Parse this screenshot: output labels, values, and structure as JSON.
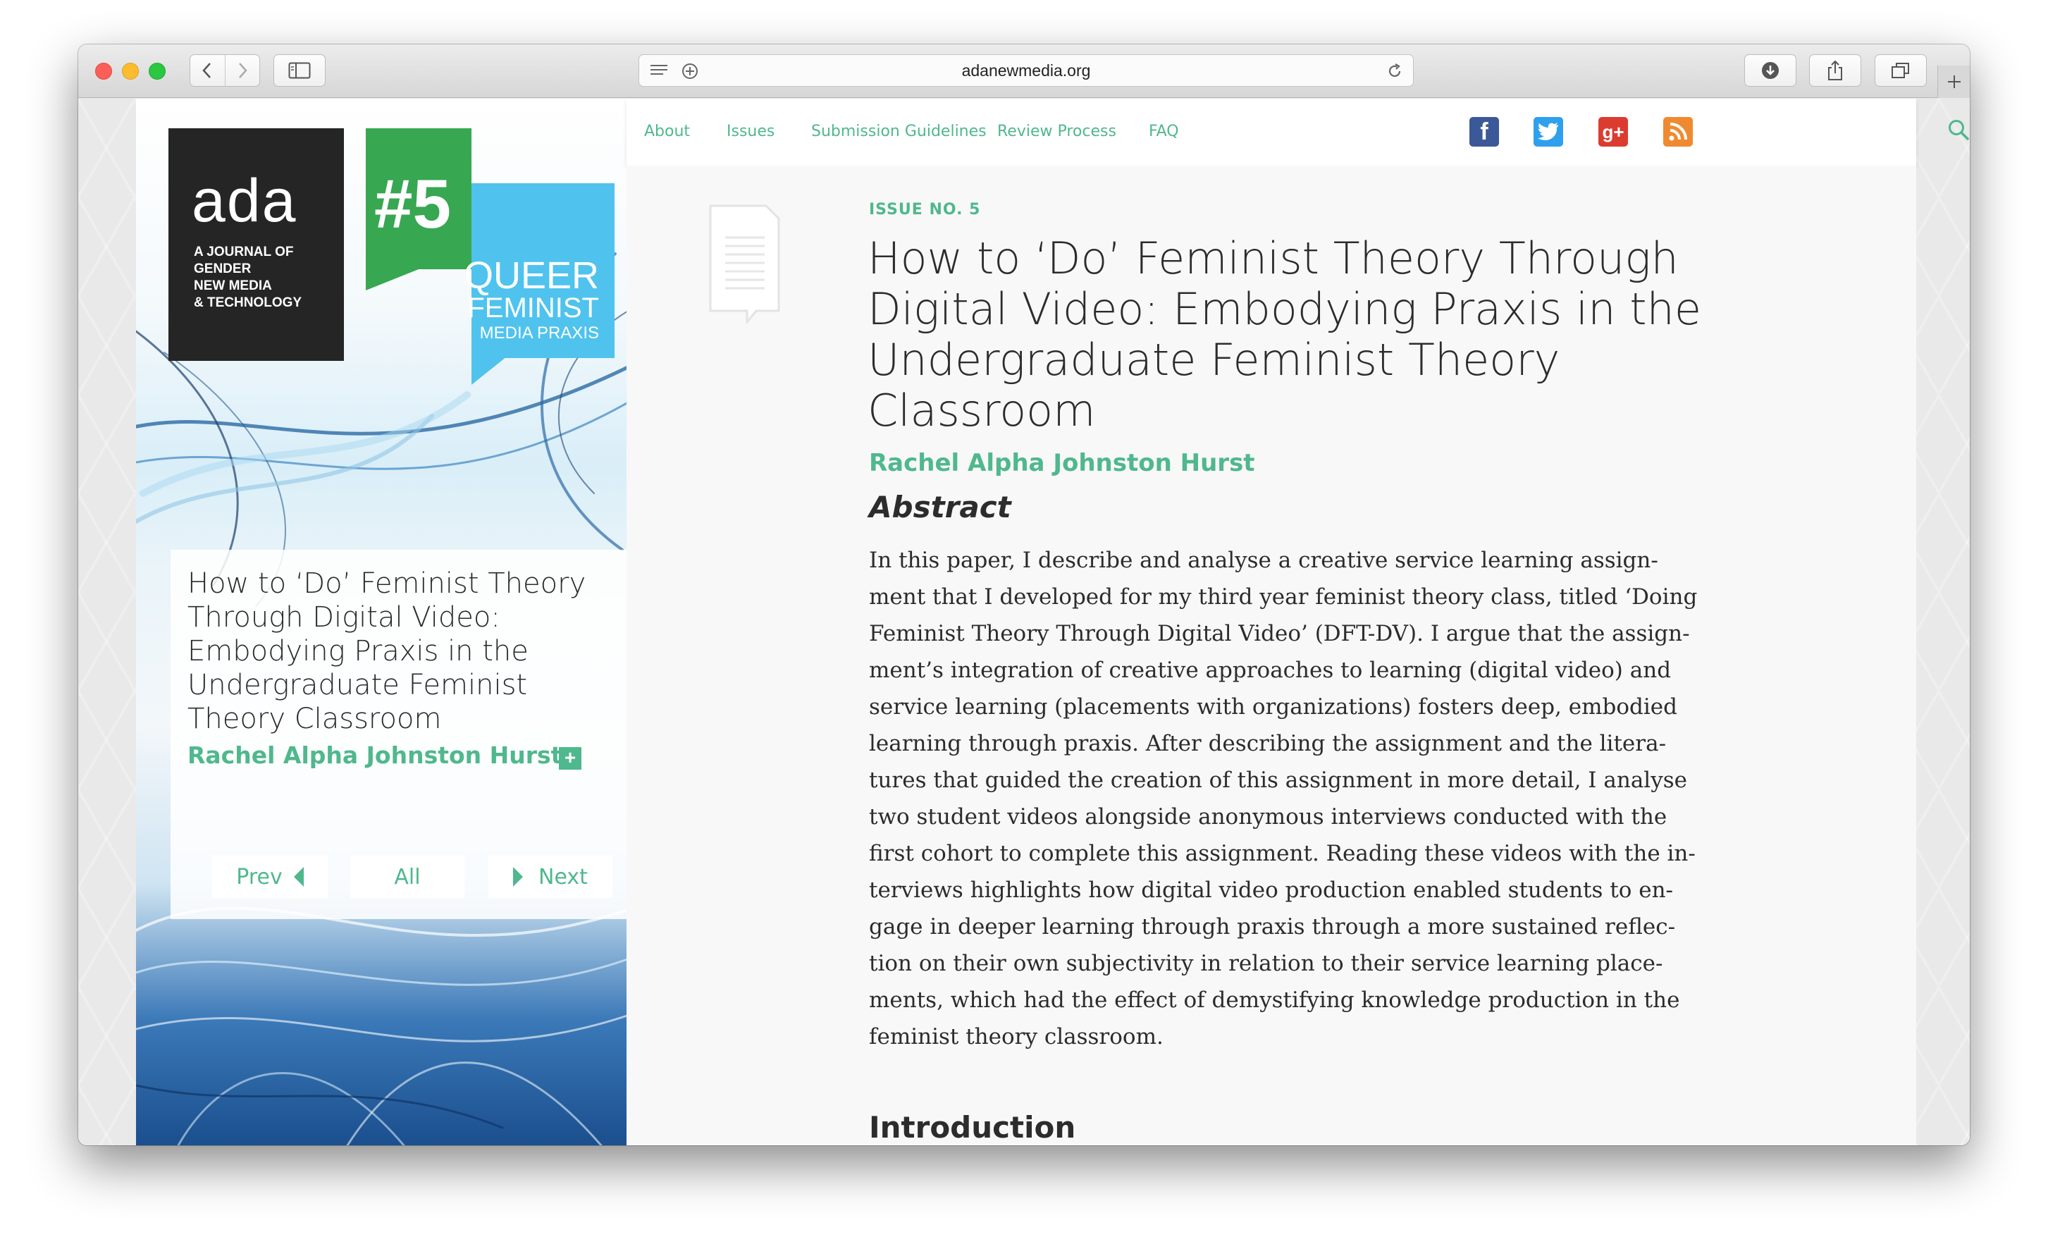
{
  "browser": {
    "url": "adanewmedia.org"
  },
  "cover": {
    "logo": "ada",
    "tagline": [
      "A JOURNAL OF",
      "GENDER",
      "NEW MEDIA",
      "& TECHNOLOGY"
    ],
    "issue_number": "#5",
    "issue_theme": [
      "QUEER",
      "FEMINIST",
      "MEDIA PRAXIS"
    ],
    "card_title": "How to ‘Do’ Feminist Theory Through Digital Video: Embodying Praxis in the Undergraduate Feminist Theory Classroom",
    "card_author": "Rachel Alpha Johnston Hurst",
    "expand_symbol": "+",
    "pager": {
      "prev": "Prev",
      "all": "All",
      "next": "Next"
    }
  },
  "nav": {
    "items": [
      "About",
      "Issues",
      "Submission Guidelines",
      "Review Process",
      "FAQ"
    ]
  },
  "social": {
    "facebook": "f",
    "googleplus": "g+"
  },
  "article": {
    "issue_label": "ISSUE NO. 5",
    "title": "How to ‘Do’ Feminist Theory Through Digital Video: Embodying Praxis in the Undergraduate Feminist Theory Classroom",
    "author": "Rachel Alpha Johnston Hurst",
    "abstract_heading": "Abstract",
    "abstract_lines": [
      "In this paper, I describe and analyse a creative service learning assign-",
      "ment that I developed for my third year feminist theory class, titled ‘Doing",
      "Feminist Theory Through Digital Video’ (DFT-DV). I argue that the assign-",
      "ment’s integration of creative approaches to learning (digital video) and",
      "service learning (placements with organizations) fosters deep, embodied",
      "learning through praxis. After describing the assignment and the litera-",
      "tures that guided the creation of this assignment in more detail, I analyse",
      "two student videos alongside anonymous interviews conducted with the",
      "first cohort to complete this assignment. Reading these videos with the in-",
      "terviews highlights how digital video production enabled students to en-",
      "gage in deeper learning through praxis through a more sustained reflec-",
      "tion on their own subjectivity in relation to their service learning place-",
      "ments, which had the effect of demystifying knowledge production in the",
      "feminist theory classroom."
    ],
    "next_heading": "Introduction"
  },
  "colors": {
    "accent_green": "#4fb88d",
    "issue_green": "#37a751",
    "issue_blue": "#4fc3ee",
    "facebook": "#3b5998",
    "twitter": "#2fa0ee",
    "googleplus": "#dc3c30",
    "rss": "#f08a30"
  }
}
